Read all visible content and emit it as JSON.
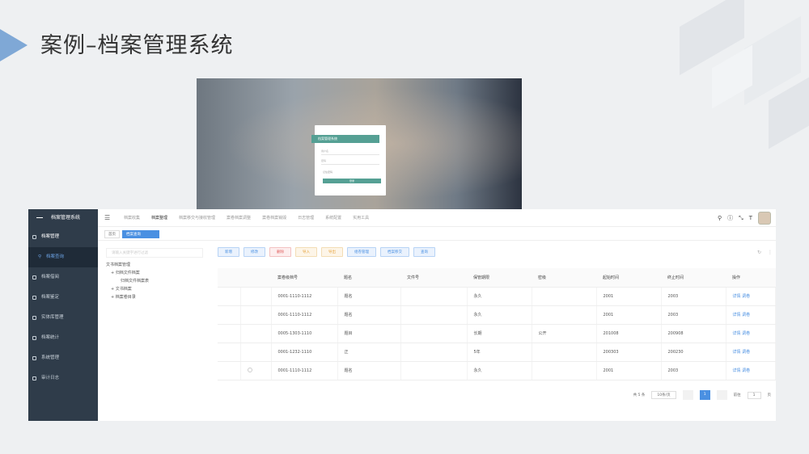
{
  "slide": {
    "title": "案例–档案管理系统"
  },
  "login": {
    "header": "档案管理系统",
    "username_placeholder": "用户名",
    "password_placeholder": "密码",
    "remember": "记住密码",
    "login_button": "登录"
  },
  "sidebar": {
    "app_name": "档案管理系统",
    "items": [
      {
        "label": "档案管理",
        "icon": "folder-icon"
      },
      {
        "label": "档案查询",
        "icon": "search-icon"
      },
      {
        "label": "档案借阅",
        "icon": "book-icon"
      },
      {
        "label": "档案鉴定",
        "icon": "check-icon"
      },
      {
        "label": "实体库管理",
        "icon": "box-icon"
      },
      {
        "label": "档案统计",
        "icon": "chart-icon"
      },
      {
        "label": "系统管理",
        "icon": "gear-icon"
      },
      {
        "label": "审计日志",
        "icon": "log-icon"
      }
    ]
  },
  "topbar": {
    "tabs": [
      "档案收集",
      "档案整理",
      "档案移交与接收管理",
      "案卷档案调整",
      "案卷档案销毁",
      "日志管理",
      "系统配置",
      "实用工具"
    ]
  },
  "tags": {
    "home": "首页",
    "current": "档案查询"
  },
  "tree": {
    "search_placeholder": "请输入关键字进行过滤",
    "nodes": [
      "文书档案管理",
      "+ 归档文件档案",
      "归档文件档案表",
      "+ 文书档案",
      "+ 档案卷目录"
    ]
  },
  "toolbar": {
    "buttons": [
      {
        "label": "新增",
        "style": "blue"
      },
      {
        "label": "修改",
        "style": "blue"
      },
      {
        "label": "删除",
        "style": "red"
      },
      {
        "label": "导入",
        "style": "orange"
      },
      {
        "label": "导出",
        "style": "orange"
      },
      {
        "label": "组卷管理",
        "style": "blue"
      },
      {
        "label": "档案移交",
        "style": "blue"
      },
      {
        "label": "查询",
        "style": "blue"
      }
    ]
  },
  "table": {
    "headers": [
      "",
      "",
      "案卷级档号",
      "题名",
      "文件号",
      "保管期限",
      "密级",
      "起始时间",
      "终止时间",
      "操作"
    ],
    "rows": [
      [
        "",
        "",
        "0001-1110-1112",
        "题名",
        "",
        "永久",
        "",
        "2001",
        "2003",
        "详情  调卷"
      ],
      [
        "",
        "",
        "0001-1110-1112",
        "题名",
        "",
        "永久",
        "",
        "2001",
        "2003",
        "详情  调卷"
      ],
      [
        "",
        "",
        "0005-1303-1110",
        "题目",
        "",
        "长期",
        "公开",
        "201008",
        "200908",
        "详情  调卷"
      ],
      [
        "",
        "",
        "0001-1232-1110",
        "正",
        "",
        "5年",
        "",
        "200303",
        "200230",
        "详情  调卷"
      ],
      [
        "",
        "",
        "0001-1110-1112",
        "题名",
        "",
        "永久",
        "",
        "2001",
        "2003",
        "详情  调卷"
      ]
    ]
  },
  "pager": {
    "total": "共 5 条",
    "size": "10条/页",
    "current": "1",
    "goto": "前往",
    "goto_page": "1",
    "unit": "页"
  }
}
